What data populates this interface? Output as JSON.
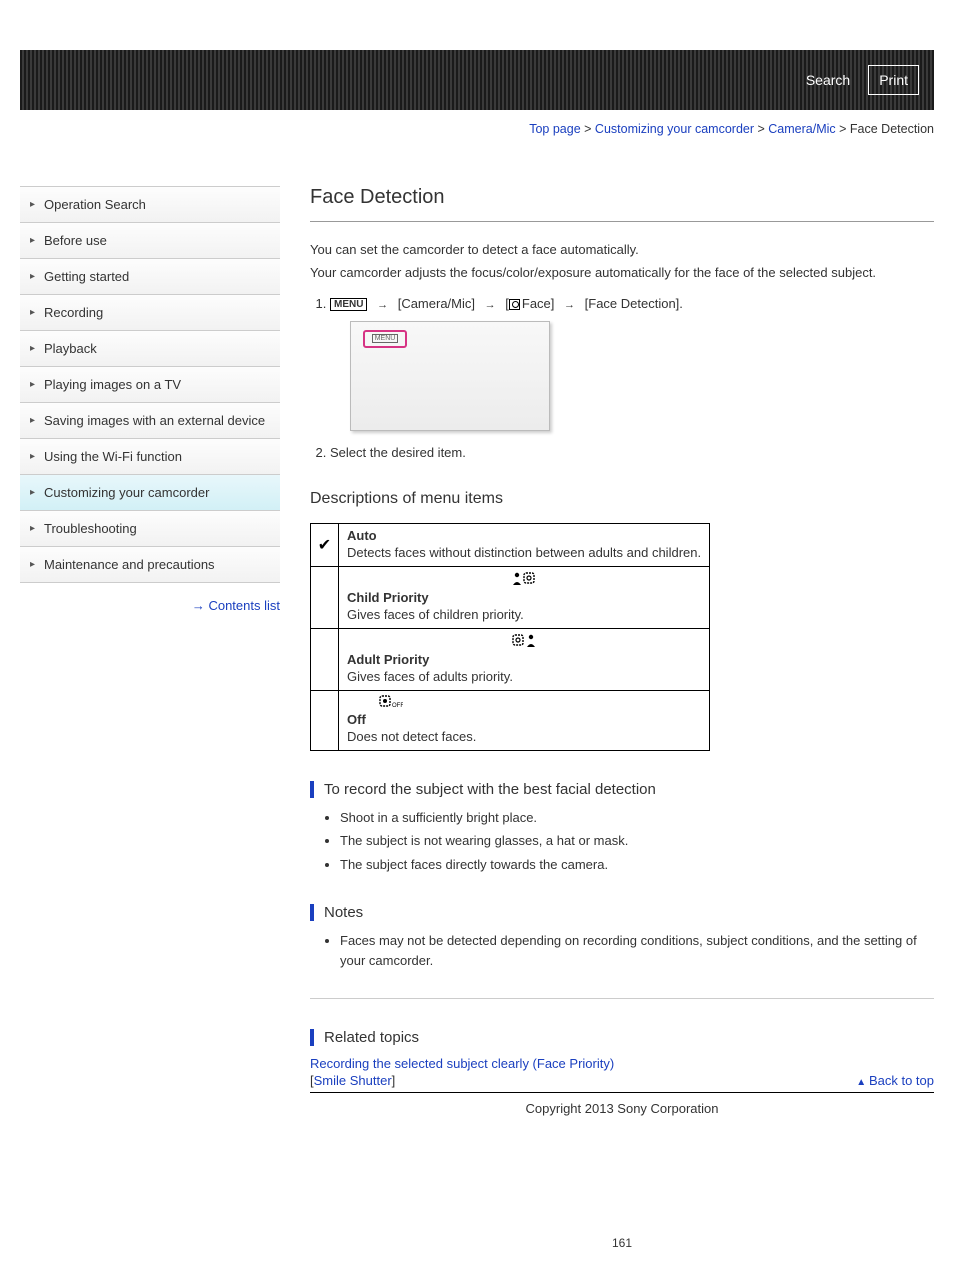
{
  "header": {
    "search": "Search",
    "print": "Print"
  },
  "breadcrumb": {
    "top": "Top page",
    "l1": "Customizing your camcorder",
    "l2": "Camera/Mic",
    "current": "Face Detection"
  },
  "sidebar": {
    "items": [
      "Operation Search",
      "Before use",
      "Getting started",
      "Recording",
      "Playback",
      "Playing images on a TV",
      "Saving images with an external device",
      "Using the Wi-Fi function",
      "Customizing your camcorder",
      "Troubleshooting",
      "Maintenance and precautions"
    ],
    "contents_link": "Contents list"
  },
  "main": {
    "title": "Face Detection",
    "intro1": "You can set the camcorder to detect a face automatically.",
    "intro2": "Your camcorder adjusts the focus/color/exposure automatically for the face of the selected subject.",
    "step1_parts": {
      "menu": "MENU",
      "p1": "[Camera/Mic]",
      "p2_prefix": "[",
      "p2_label": "Face]",
      "p3": "[Face Detection]."
    },
    "step2": "Select the desired item.",
    "options_heading": "Descriptions of menu items",
    "options": [
      {
        "label": "Auto",
        "desc": "Detects faces without distinction between adults and children."
      },
      {
        "label": "Child Priority",
        "desc": "Gives faces of children priority."
      },
      {
        "label": "Adult Priority",
        "desc": "Gives faces of adults priority."
      },
      {
        "label": "Off",
        "desc": "Does not detect faces."
      }
    ],
    "tips_heading": "To record the subject with the best facial detection",
    "tips": [
      "Shoot in a sufficiently bright place.",
      "The subject is not wearing glasses, a hat or mask.",
      "The subject faces directly towards the camera."
    ],
    "notes_heading": "Notes",
    "notes": [
      "Faces may not be detected depending on recording conditions, subject conditions, and the setting of your camcorder."
    ],
    "related_heading": "Related topics",
    "related": [
      "Recording the selected subject clearly (Face Priority)",
      "Smile Shutter"
    ],
    "back_to_top": "Back to top",
    "copyright": "Copyright 2013 Sony Corporation",
    "page_number": "161"
  }
}
